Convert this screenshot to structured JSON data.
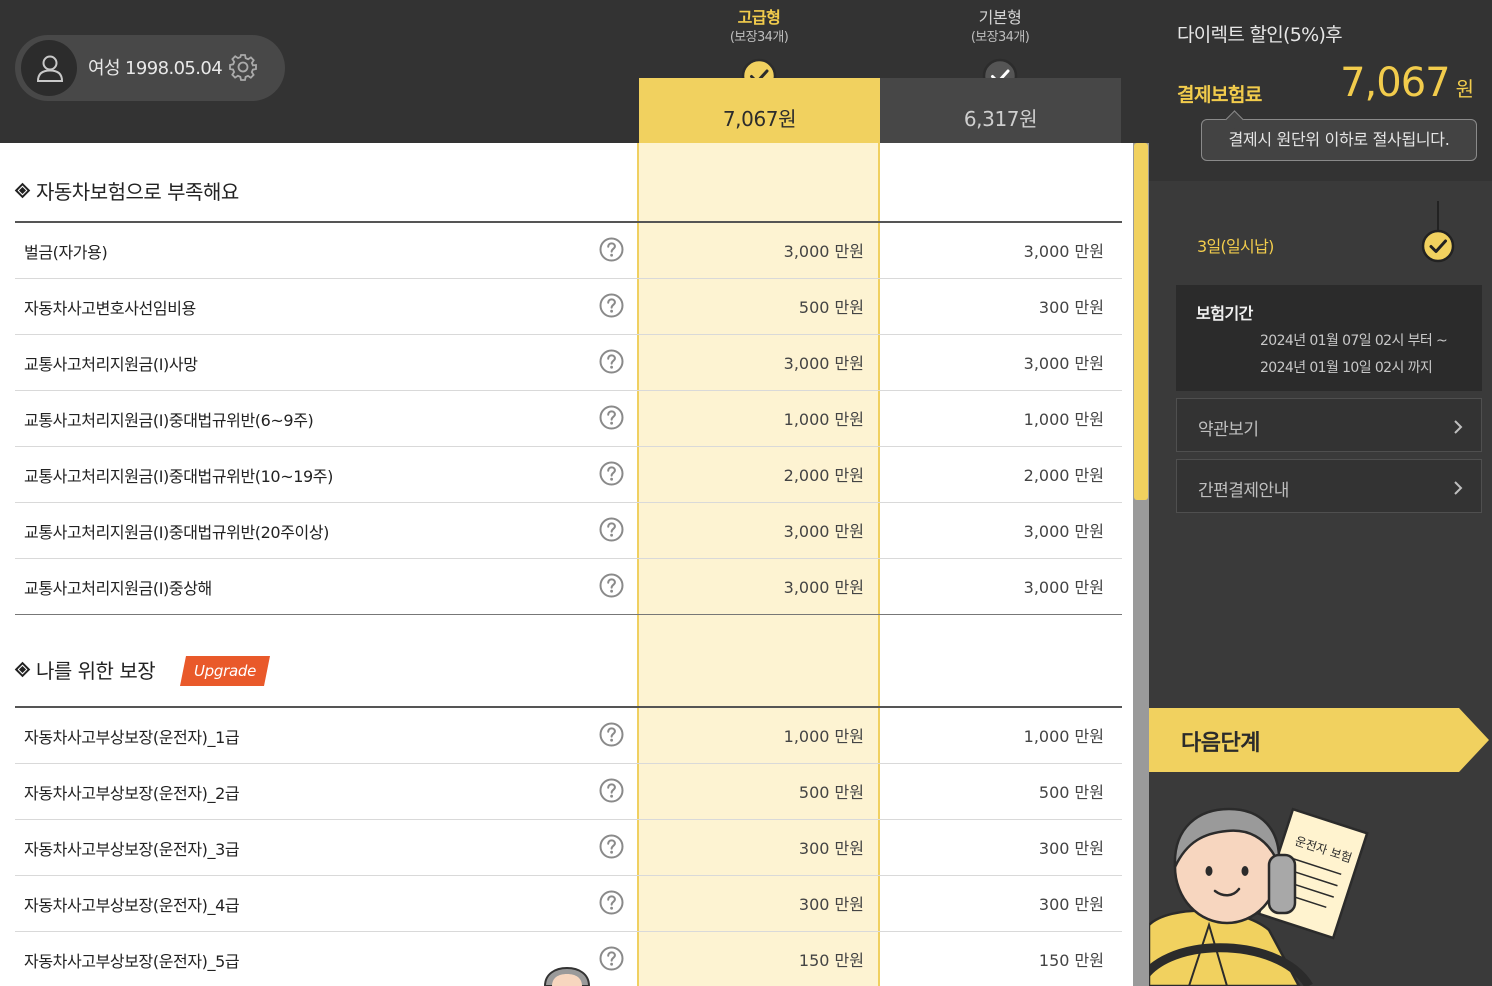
{
  "user": {
    "info": "여성 1998.05.04"
  },
  "plans": [
    {
      "name": "고급형",
      "sub": "(보장34개)",
      "price": "7,067원",
      "selected": true
    },
    {
      "name": "기본형",
      "sub": "(보장34개)",
      "price": "6,317원",
      "selected": false
    }
  ],
  "summary": {
    "discount_label": "다이렉트 할인(5%)후",
    "premium_label": "결제보험료",
    "premium_value": "7,067",
    "premium_unit": "원",
    "tooltip": "결제시 원단위 이하로 절사됩니다.",
    "day_option": "3일(일시납)",
    "period_title": "보험기간",
    "period_from": "2024년 01월 07일 02시 부터 ~",
    "period_to": "2024년 01월 10일 02시 까지",
    "terms_link": "약관보기",
    "pay_link": "간편결제안내",
    "next_button": "다음단계"
  },
  "sections": [
    {
      "title": "자동차보험으로 부족해요",
      "rows": [
        {
          "name": "벌금(자가용)",
          "premium": "3,000 만원",
          "basic": "3,000 만원"
        },
        {
          "name": "자동차사고변호사선임비용",
          "premium": "500 만원",
          "basic": "300 만원"
        },
        {
          "name": "교통사고처리지원금(I)사망",
          "premium": "3,000 만원",
          "basic": "3,000 만원"
        },
        {
          "name": "교통사고처리지원금(I)중대법규위반(6~9주)",
          "premium": "1,000 만원",
          "basic": "1,000 만원"
        },
        {
          "name": "교통사고처리지원금(I)중대법규위반(10~19주)",
          "premium": "2,000 만원",
          "basic": "2,000 만원"
        },
        {
          "name": "교통사고처리지원금(I)중대법규위반(20주이상)",
          "premium": "3,000 만원",
          "basic": "3,000 만원"
        },
        {
          "name": "교통사고처리지원금(I)중상해",
          "premium": "3,000 만원",
          "basic": "3,000 만원"
        }
      ]
    },
    {
      "title": "나를 위한 보장",
      "badge": "Upgrade",
      "rows": [
        {
          "name": "자동차사고부상보장(운전자)_1급",
          "premium": "1,000 만원",
          "basic": "1,000 만원"
        },
        {
          "name": "자동차사고부상보장(운전자)_2급",
          "premium": "500 만원",
          "basic": "500 만원"
        },
        {
          "name": "자동차사고부상보장(운전자)_3급",
          "premium": "300 만원",
          "basic": "300 만원"
        },
        {
          "name": "자동차사고부상보장(운전자)_4급",
          "premium": "300 만원",
          "basic": "300 만원"
        },
        {
          "name": "자동차사고부상보장(운전자)_5급",
          "premium": "150 만원",
          "basic": "150 만원"
        }
      ]
    }
  ],
  "mascot_sign": "운전자 보험",
  "colors": {
    "accent": "#f1d15f",
    "dark": "#333333",
    "badge": "#e9592a"
  }
}
